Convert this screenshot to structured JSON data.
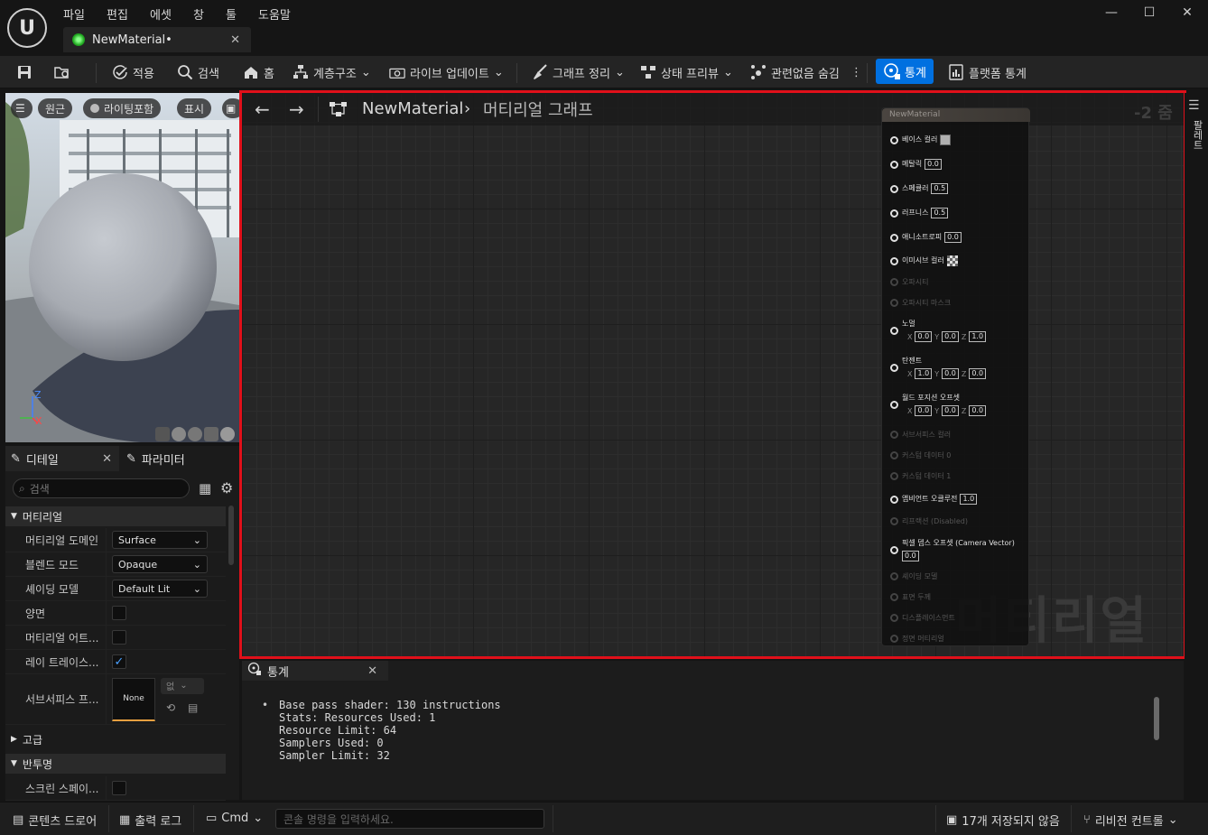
{
  "menu": [
    "파일",
    "편집",
    "에셋",
    "창",
    "툴",
    "도움말"
  ],
  "document_tab": {
    "label": "NewMaterial•"
  },
  "window_controls": {
    "minimize": "—",
    "maximize": "☐",
    "close": "✕"
  },
  "toolbar": {
    "apply": "적용",
    "search": "검색",
    "home": "홈",
    "hierarchy": "계층구조",
    "live_update": "라이브 업데이트",
    "graph_cleanup": "그래프 정리",
    "state_preview": "상태 프리뷰",
    "hide_unrelated": "관련없음 숨김",
    "stats": "통계",
    "platform_stats": "플랫폼 통계"
  },
  "viewport": {
    "perspective": "원근",
    "lit": "라이팅포함",
    "show": "표시",
    "axis_z": "Z",
    "axis_x": "X"
  },
  "panels": {
    "details_tab": "디테일",
    "params_tab": "파라미터",
    "search_placeholder": "검색",
    "section_material": "머티리얼",
    "rows": [
      {
        "label": "머티리얼 도메인",
        "value": "Surface"
      },
      {
        "label": "블렌드 모드",
        "value": "Opaque"
      },
      {
        "label": "셰이딩 모델",
        "value": "Default Lit"
      },
      {
        "label": "양면",
        "checked": false
      },
      {
        "label": "머티리얼 어트...",
        "checked": false
      },
      {
        "label": "레이 트레이스...",
        "checked": true
      }
    ],
    "subsurface_label": "서브서피스 프...",
    "subsurface_thumb": "None",
    "subsurface_combo": "없",
    "section_advanced": "고급",
    "section_translucency": "반투명",
    "screen_space_label": "스크린 스페이..."
  },
  "graph": {
    "breadcrumb_root": "NewMaterial",
    "breadcrumb_sub": "머티리얼 그래프",
    "zoom": "-2 줌",
    "watermark": "머티리얼",
    "node_title": "NewMaterial",
    "pins": [
      {
        "label": "베이스 컬러",
        "kind": "swatch",
        "active": true
      },
      {
        "label": "메탈릭",
        "value": "0.0",
        "active": true
      },
      {
        "label": "스페큘러",
        "value": "0.5",
        "active": true
      },
      {
        "label": "러프니스",
        "value": "0.5",
        "active": true
      },
      {
        "label": "애니소트로피",
        "value": "0.0",
        "active": true
      },
      {
        "label": "이미시브 컬러",
        "kind": "checker",
        "active": true
      },
      {
        "label": "오파시티",
        "active": false
      },
      {
        "label": "오파시티 마스크",
        "active": false
      },
      {
        "label": "노멀",
        "xyz": [
          "0.0",
          "0.0",
          "1.0"
        ],
        "active": true
      },
      {
        "label": "탄젠트",
        "xyz": [
          "1.0",
          "0.0",
          "0.0"
        ],
        "active": true
      },
      {
        "label": "월드 포지션 오프셋",
        "xyz": [
          "0.0",
          "0.0",
          "0.0"
        ],
        "active": true
      },
      {
        "label": "서브서피스 컬러",
        "active": false
      },
      {
        "label": "커스텀 데이터 0",
        "active": false
      },
      {
        "label": "커스텀 데이터 1",
        "active": false
      },
      {
        "label": "앰비언트 오클루전",
        "value": "1.0",
        "active": true
      },
      {
        "label": "리프랙션 (Disabled)",
        "active": false
      },
      {
        "label": "픽셀 뎁스 오프셋 (Camera Vector)",
        "value": "0.0",
        "active": true
      },
      {
        "label": "셰이딩 모델",
        "active": false
      },
      {
        "label": "표면 두께",
        "active": false
      },
      {
        "label": "디스플레이스먼트",
        "active": false
      },
      {
        "label": "정면 머티리얼",
        "active": false
      }
    ]
  },
  "stats_panel": {
    "tab": "통계",
    "lines": [
      "Base pass shader: 130 instructions",
      "Stats: Resources Used: 1",
      "Resource Limit: 64",
      "Samplers Used: 0",
      "Sampler Limit: 32"
    ],
    "bullet": "•"
  },
  "statusbar": {
    "content_drawer": "콘텐츠 드로어",
    "output_log": "출력 로그",
    "cmd": "Cmd",
    "cmd_placeholder": "콘솔 명령을 입력하세요.",
    "unsaved": "17개 저장되지 않음",
    "revision": "리비전 컨트롤"
  },
  "right_strip": {
    "label": "팔레트"
  }
}
